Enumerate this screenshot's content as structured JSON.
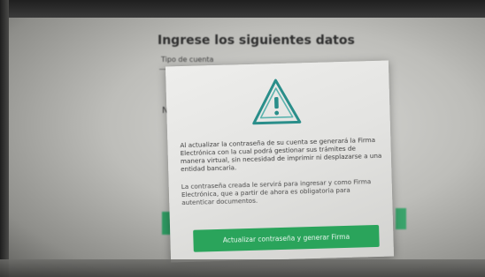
{
  "background_page": {
    "title": "Ingrese los siguientes datos",
    "field_label": "Tipo de cuenta",
    "side_letter": "N"
  },
  "modal": {
    "icon": "warning-triangle-icon",
    "paragraph_1": "Al actualizar la contraseña de su cuenta se generará la Firma Electrónica con la cual podrá gestionar sus trámites de manera virtual, sin necesidad de imprimir ni desplazarse a una entidad bancaria.",
    "paragraph_2": "La contraseña creada le servirá para ingresar y como Firma Electrónica, que a partir de ahora es obligatoria para autenticar documentos.",
    "button_label": "Actualizar contraseña y generar Firma"
  },
  "colors": {
    "accent_green": "#2aa45b",
    "icon_teal": "#2a8e8a"
  }
}
